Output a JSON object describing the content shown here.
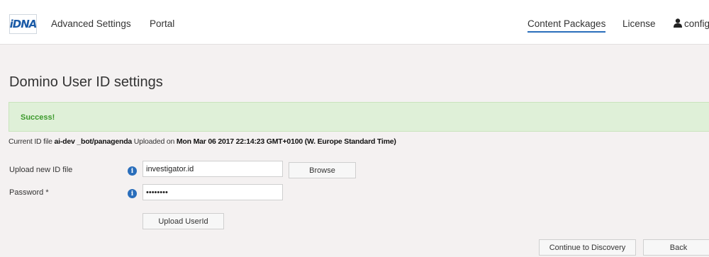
{
  "header": {
    "logo_text": "iDNA",
    "nav_left": [
      "Advanced Settings",
      "Portal"
    ],
    "nav_right": [
      "Content Packages",
      "License"
    ],
    "active_nav": "Content Packages",
    "user_label": "config"
  },
  "page": {
    "title": "Domino User ID settings"
  },
  "alert": {
    "text": "Success!"
  },
  "current_id": {
    "prefix": "Current ID file",
    "file": "ai-dev _bot/panagenda",
    "middle": "Uploaded on",
    "date": "Mon Mar 06 2017 22:14:23 GMT+0100 (W. Europe Standard Time)"
  },
  "form": {
    "upload_label": "Upload new ID file",
    "upload_value": "investigator.id",
    "browse_label": "Browse",
    "password_label": "Password *",
    "password_value": "••••••••",
    "upload_button": "Upload UserId"
  },
  "footer_buttons": {
    "continue": "Continue to Discovery",
    "back": "Back"
  },
  "colors": {
    "accent": "#2a6ebb",
    "success_bg": "#dff0d8",
    "success_text": "#3c9a2c"
  }
}
